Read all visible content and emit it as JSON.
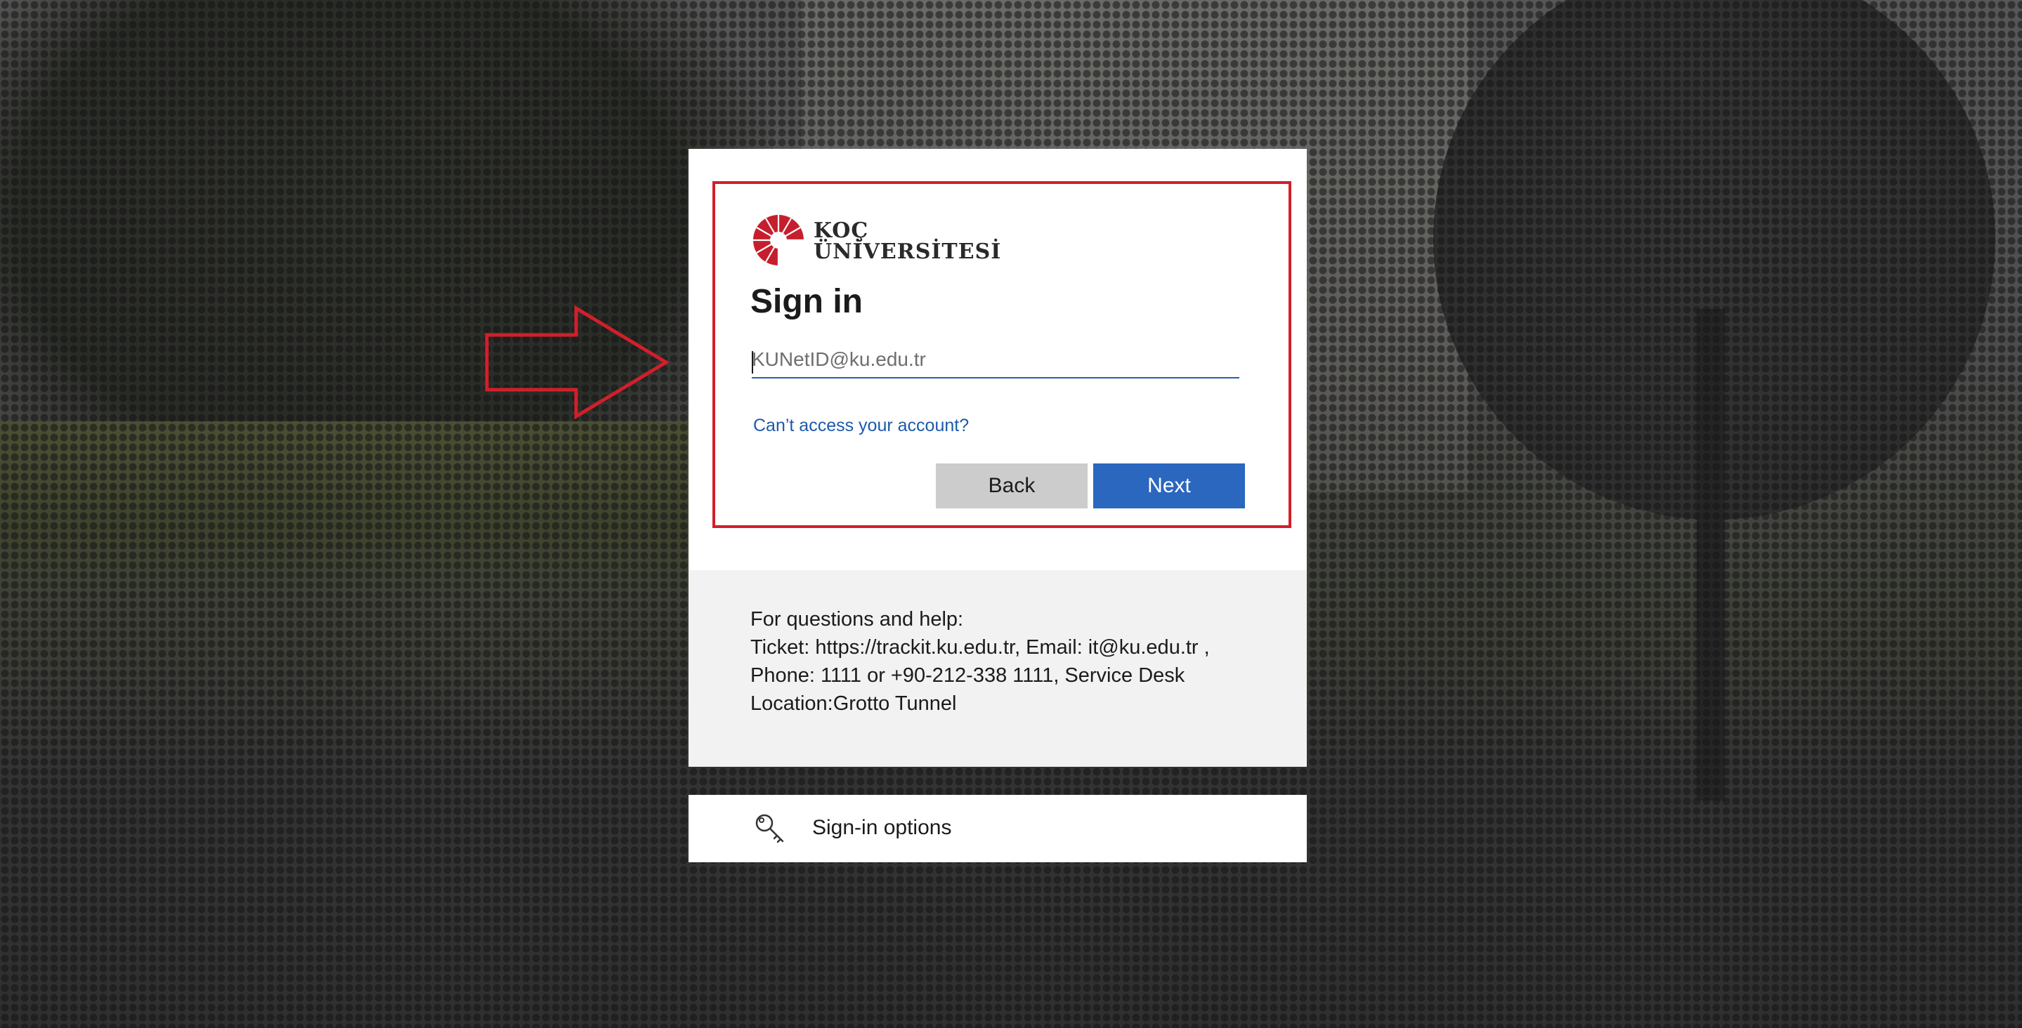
{
  "brand": {
    "name_line1": "KOÇ",
    "name_line2": "ÜNİVERSİTESİ",
    "color": "#c51f2e"
  },
  "signin": {
    "title": "Sign in",
    "email_placeholder": "KUNetID@ku.edu.tr",
    "email_value": "",
    "cant_access_link": "Can’t access your account?",
    "back_label": "Back",
    "next_label": "Next"
  },
  "help": {
    "lines": [
      "For questions and help:",
      "Ticket: https://trackit.ku.edu.tr, Email: it@ku.edu.tr ,",
      "Phone: 1111 or +90-212-338 1111, Service Desk",
      "Location:Grotto Tunnel"
    ]
  },
  "signin_options": {
    "label": "Sign-in options",
    "icon": "key-icon"
  },
  "annotation": {
    "highlight_color": "#d21f2b"
  },
  "colors": {
    "primary_button": "#2b66bf",
    "secondary_button": "#cccccc",
    "link": "#1c5aa9"
  }
}
